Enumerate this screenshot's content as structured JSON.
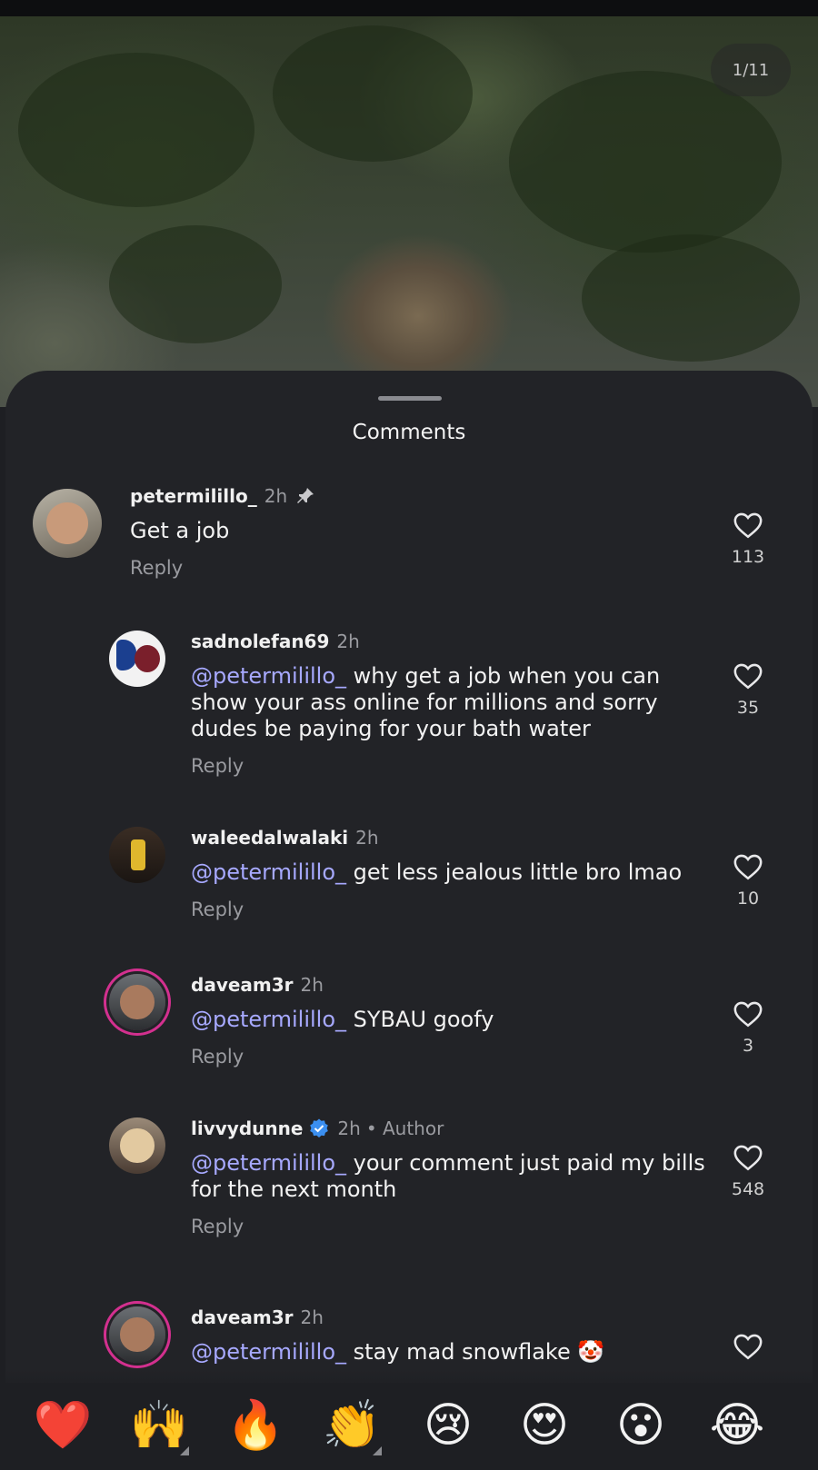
{
  "media": {
    "page_counter": "1/11"
  },
  "sheet": {
    "title": "Comments"
  },
  "comments": [
    {
      "username": "petermilillo_",
      "time": "2h",
      "pinned": true,
      "mention": "",
      "text": "Get a job",
      "reply_label": "Reply",
      "likes": "113"
    },
    {
      "username": "sadnolefan69",
      "time": "2h",
      "mention": "@petermilillo_",
      "text": " why get a job when you can show your ass online for millions and sorry dudes be paying for your bath water",
      "reply_label": "Reply",
      "likes": "35"
    },
    {
      "username": "waleedalwalaki",
      "time": "2h",
      "mention": "@petermilillo_",
      "text": " get less jealous little bro lmao",
      "reply_label": "Reply",
      "likes": "10"
    },
    {
      "username": "daveam3r",
      "time": "2h",
      "mention": "@petermilillo_",
      "text": " SYBAU goofy",
      "reply_label": "Reply",
      "likes": "3"
    },
    {
      "username": "livvydunne",
      "verified": true,
      "time": "2h",
      "author_label": "• Author",
      "mention": "@petermilillo_",
      "text": " your comment just paid my bills for the next month",
      "reply_label": "Reply",
      "likes": "548"
    },
    {
      "username": "daveam3r",
      "time": "2h",
      "mention": "@petermilillo_",
      "text": " stay mad snowflake 🤡",
      "reply_label": "",
      "likes": ""
    }
  ],
  "quick_reactions": [
    {
      "emoji": "❤️",
      "name": "heart"
    },
    {
      "emoji": "🙌",
      "name": "raising-hands",
      "has_variants": true
    },
    {
      "emoji": "🔥",
      "name": "fire"
    },
    {
      "emoji": "👏",
      "name": "clapping-hands",
      "has_variants": true
    },
    {
      "emoji": "😢",
      "name": "crying-face"
    },
    {
      "emoji": "😍",
      "name": "heart-eyes"
    },
    {
      "emoji": "😮",
      "name": "open-mouth"
    },
    {
      "emoji": "😂",
      "name": "tears-of-joy"
    }
  ],
  "colors": {
    "accent_mention": "#a7a9ff",
    "sheet_bg": "#222327",
    "verified_blue": "#3b8ff0",
    "story_ring": "#d3308f"
  }
}
